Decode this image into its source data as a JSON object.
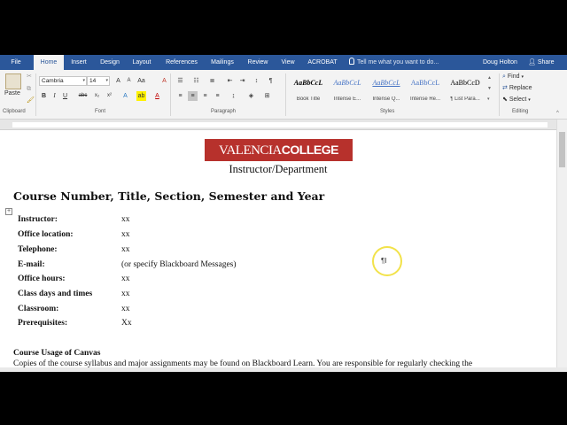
{
  "tabs": [
    "File",
    "Home",
    "Insert",
    "Design",
    "Layout",
    "References",
    "Mailings",
    "Review",
    "View",
    "ACROBAT"
  ],
  "active_tab": "Home",
  "tell_me_placeholder": "Tell me what you want to do...",
  "user_name": "Doug Holton",
  "share_label": "Share",
  "ribbon": {
    "clipboard": {
      "paste_label": "Paste",
      "group_label": "Clipboard"
    },
    "font": {
      "font_name": "Cambria",
      "font_size": "14",
      "group_label": "Font"
    },
    "paragraph": {
      "group_label": "Paragraph"
    },
    "styles": {
      "group_label": "Styles",
      "items": [
        {
          "sample": "AaBbCcL",
          "name": "Book Title"
        },
        {
          "sample": "AaBbCcL",
          "name": "Intense E..."
        },
        {
          "sample": "AaBbCcL",
          "name": "Intense Q..."
        },
        {
          "sample": "AaBbCcL",
          "name": "Intense Re..."
        },
        {
          "sample": "AaBbCcD",
          "name": "¶ List Para..."
        }
      ]
    },
    "editing": {
      "find_label": "Find",
      "replace_label": "Replace",
      "select_label": "Select",
      "group_label": "Editing"
    }
  },
  "document": {
    "logo_prefix": "VALENCIA",
    "logo_suffix": "COLLEGE",
    "department": "Instructor/Department",
    "course_title": "Course Number, Title, Section, Semester and Year",
    "info_rows": [
      {
        "label": "Instructor:",
        "value": "xx"
      },
      {
        "label": "Office location:",
        "value": "xx"
      },
      {
        "label": "Telephone:",
        "value": "xx"
      },
      {
        "label": "E-mail:",
        "value": "(or specify Blackboard Messages)"
      },
      {
        "label": "Office hours:",
        "value": "xx"
      },
      {
        "label": "Class days and times",
        "value": "xx"
      },
      {
        "label": "Classroom:",
        "value": "xx"
      },
      {
        "label": "Prerequisites:",
        "value": "Xx"
      }
    ],
    "canvas_heading": "Course Usage of Canvas",
    "canvas_text": "Copies of the course syllabus and major assignments may be found on Blackboard Learn.  You are responsible for regularly checking the"
  },
  "colors": {
    "ribbon_blue": "#2b579a",
    "logo_red": "#b7312c"
  }
}
